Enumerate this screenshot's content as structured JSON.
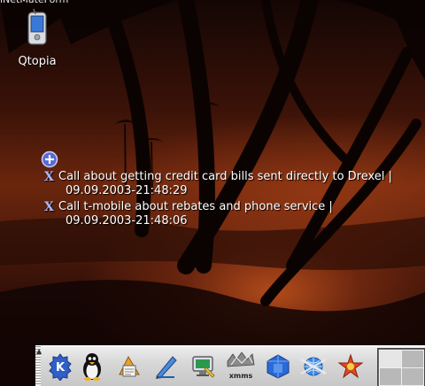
{
  "window": {
    "partial_title": "iNetMateForm"
  },
  "desktop": {
    "icons": [
      {
        "label": "Qtopia",
        "icon": "qtopia-pda-icon"
      }
    ]
  },
  "todo_applet": {
    "add_icon": "add-circle-icon",
    "items": [
      {
        "icon": "x-bullet-icon",
        "title": "Call about getting credit card bills sent directly to Drexel |",
        "timestamp": "09.09.2003-21:48:29"
      },
      {
        "icon": "x-bullet-icon",
        "title": "Call t-mobile about rebates and phone service |",
        "timestamp": "09.09.2003-21:48:06"
      }
    ]
  },
  "taskbar": {
    "launchers": [
      {
        "name": "kde-menu-icon"
      },
      {
        "name": "tux-penguin-icon"
      },
      {
        "name": "office-suite-icon"
      },
      {
        "name": "text-editor-icon"
      },
      {
        "name": "display-settings-icon"
      },
      {
        "name": "xmms-icon",
        "label": "xmms"
      },
      {
        "name": "file-manager-icon"
      },
      {
        "name": "web-browser-icon"
      },
      {
        "name": "app-launcher-icon"
      }
    ],
    "pager": {
      "desktops": 4,
      "active": 1
    }
  }
}
